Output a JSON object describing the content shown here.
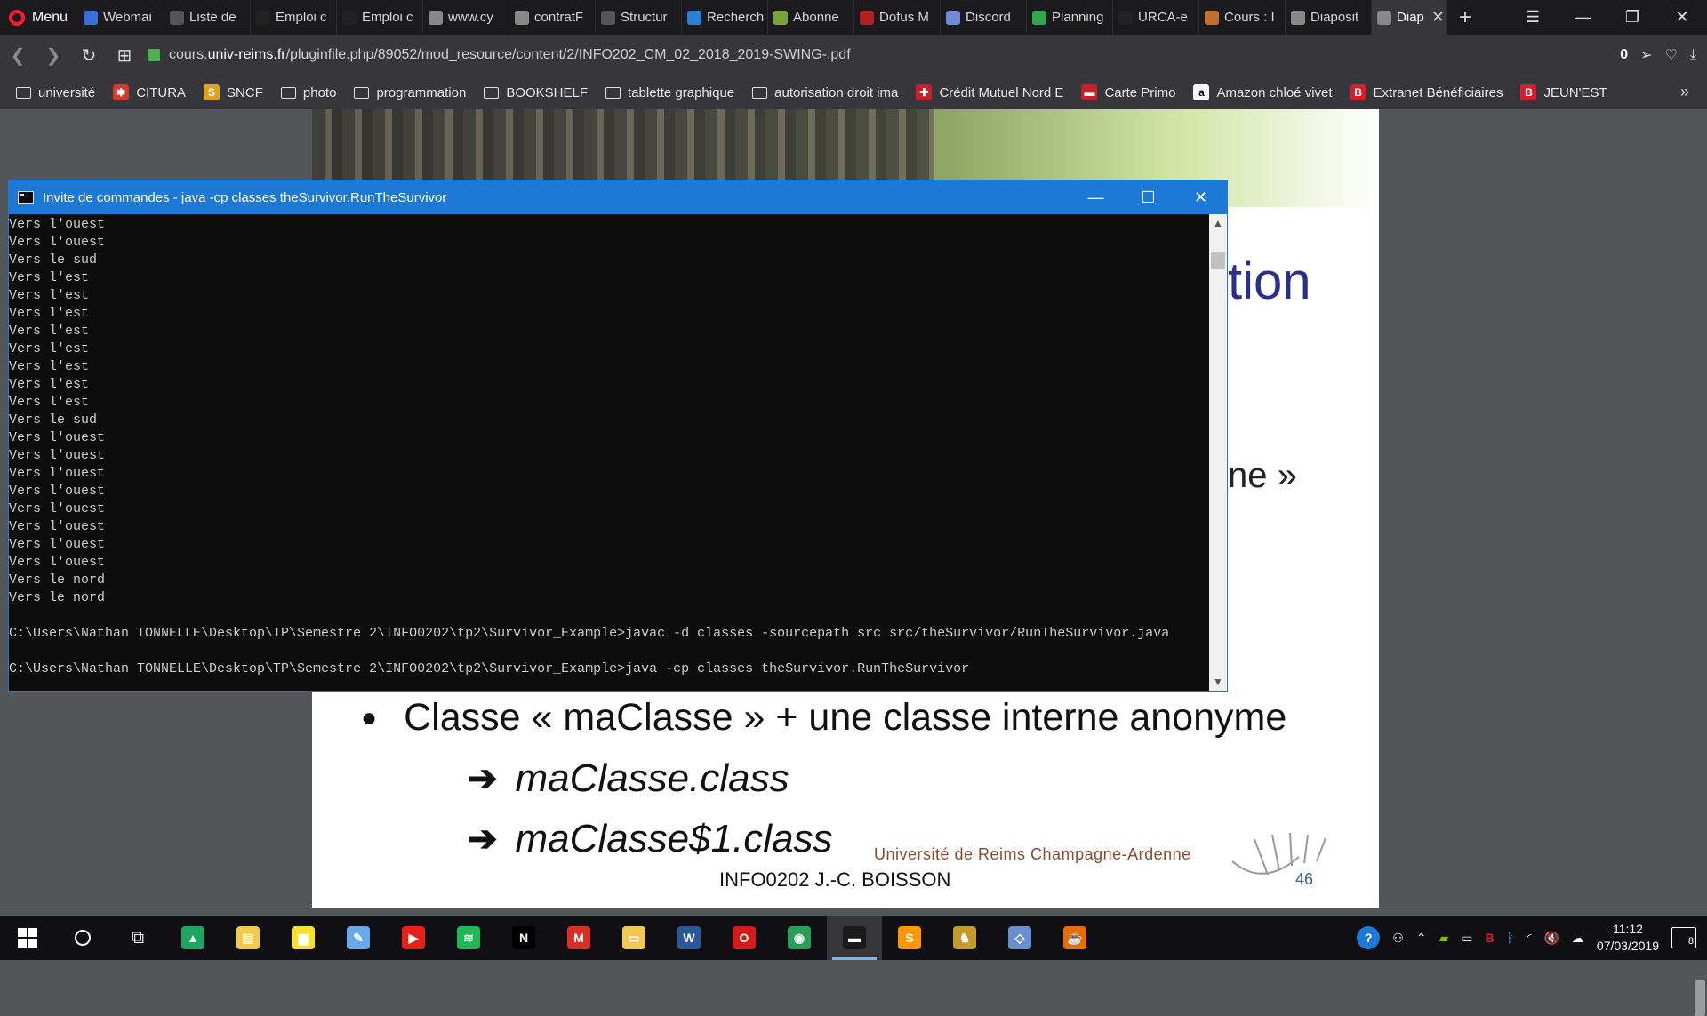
{
  "browser": {
    "menu_label": "Menu",
    "tabs": [
      {
        "label": "Webmai",
        "color": "#3b6fd8"
      },
      {
        "label": "Liste de",
        "color": "#555555"
      },
      {
        "label": "Emploi c",
        "color": "#222222"
      },
      {
        "label": "Emploi c",
        "color": "#222222"
      },
      {
        "label": "www.cy",
        "color": "#888888"
      },
      {
        "label": "contratF",
        "color": "#888888"
      },
      {
        "label": "Structur",
        "color": "#555555"
      },
      {
        "label": "Recherch",
        "color": "#2b7fd6"
      },
      {
        "label": "Abonne",
        "color": "#7aa23b"
      },
      {
        "label": "Dofus M",
        "color": "#b02020"
      },
      {
        "label": "Discord",
        "color": "#7289da"
      },
      {
        "label": "Planning",
        "color": "#2fa84f"
      },
      {
        "label": "URCA-e",
        "color": "#222222"
      },
      {
        "label": "Cours : I",
        "color": "#c0702a"
      },
      {
        "label": "Diaposit",
        "color": "#888888"
      }
    ],
    "active_tab": {
      "label": "Diap",
      "color": "#888888"
    },
    "url_prefix": "cours.",
    "url_domain": "univ-reims.fr",
    "url_path": "/pluginfile.php/89052/mod_resource/content/2/INFO202_CM_02_2018_2019-SWING-.pdf",
    "adblock_count": "0"
  },
  "bookmarks": [
    {
      "label": "université",
      "type": "folder"
    },
    {
      "label": "CITURA",
      "type": "fav",
      "color": "#d43a2a",
      "glyph": "✱"
    },
    {
      "label": "SNCF",
      "type": "fav",
      "color": "#e0a020",
      "glyph": "S"
    },
    {
      "label": "photo",
      "type": "folder"
    },
    {
      "label": "programmation",
      "type": "folder"
    },
    {
      "label": "BOOKSHELF",
      "type": "folder"
    },
    {
      "label": "tablette graphique",
      "type": "folder"
    },
    {
      "label": "autorisation droit ima",
      "type": "folder"
    },
    {
      "label": "Crédit Mutuel Nord E",
      "type": "fav",
      "color": "#c8202a",
      "glyph": "✚"
    },
    {
      "label": "Carte Primo",
      "type": "fav",
      "color": "#c8202a",
      "glyph": "▬"
    },
    {
      "label": "Amazon chloé vivet",
      "type": "fav",
      "color": "#ffffff",
      "glyph": "a"
    },
    {
      "label": "Extranet Bénéficiaires",
      "type": "fav",
      "color": "#d81e2a",
      "glyph": "B"
    },
    {
      "label": "JEUN'EST",
      "type": "fav",
      "color": "#d81e2a",
      "glyph": "B"
    }
  ],
  "slide": {
    "heading_fragment_1": "tion",
    "heading_fragment_2": "ne »",
    "bullet": "Classe « maClasse » + une classe interne anonyme",
    "arrow_1": "maClasse.class",
    "arrow_2": "maClasse$1.class",
    "university": "Université de Reims Champagne-Ardenne",
    "course": "INFO0202  J.-C. BOISSON",
    "page_number": "46"
  },
  "cmd": {
    "title": "Invite de commandes - java  -cp classes theSurvivor.RunTheSurvivor",
    "lines": [
      "Vers l'ouest",
      "Vers l'ouest",
      "Vers le sud",
      "Vers l'est",
      "Vers l'est",
      "Vers l'est",
      "Vers l'est",
      "Vers l'est",
      "Vers l'est",
      "Vers l'est",
      "Vers l'est",
      "Vers le sud",
      "Vers l'ouest",
      "Vers l'ouest",
      "Vers l'ouest",
      "Vers l'ouest",
      "Vers l'ouest",
      "Vers l'ouest",
      "Vers l'ouest",
      "Vers l'ouest",
      "Vers le nord",
      "Vers le nord",
      "",
      "C:\\Users\\Nathan TONNELLE\\Desktop\\TP\\Semestre 2\\INFO0202\\tp2\\Survivor_Example>javac -d classes -sourcepath src src/theSurvivor/RunTheSurvivor.java",
      "",
      "C:\\Users\\Nathan TONNELLE\\Desktop\\TP\\Semestre 2\\INFO0202\\tp2\\Survivor_Example>java -cp classes theSurvivor.RunTheSurvivor"
    ]
  },
  "taskbar": {
    "apps": [
      {
        "name": "google-drive",
        "color": "#1fa463",
        "glyph": "▲"
      },
      {
        "name": "file-explorer-yellow",
        "color": "#f2c94c",
        "glyph": "▤"
      },
      {
        "name": "sticky-notes",
        "color": "#f7e12b",
        "glyph": "▆"
      },
      {
        "name": "paint",
        "color": "#6aa9e9",
        "glyph": "✎"
      },
      {
        "name": "youtube",
        "color": "#e62117",
        "glyph": "▶"
      },
      {
        "name": "spotify",
        "color": "#1db954",
        "glyph": "≋"
      },
      {
        "name": "netflix",
        "color": "#000000",
        "glyph": "N"
      },
      {
        "name": "gmail",
        "color": "#d93025",
        "glyph": "M"
      },
      {
        "name": "file-explorer",
        "color": "#f2c94c",
        "glyph": "▭"
      },
      {
        "name": "word",
        "color": "#2b579a",
        "glyph": "W"
      },
      {
        "name": "opera",
        "color": "#d41a1a",
        "glyph": "O"
      },
      {
        "name": "chrome",
        "color": "#2a9d57",
        "glyph": "◉"
      },
      {
        "name": "command-prompt",
        "color": "#1a1a1a",
        "glyph": "▬"
      },
      {
        "name": "sublime-text",
        "color": "#ff9800",
        "glyph": "S"
      },
      {
        "name": "game-app",
        "color": "#c49a2a",
        "glyph": "♞"
      },
      {
        "name": "virtualbox",
        "color": "#6a8fcf",
        "glyph": "◇"
      },
      {
        "name": "java",
        "color": "#e76f00",
        "glyph": "☕"
      }
    ],
    "active_app_index": 12,
    "time": "11:12",
    "date": "07/03/2019",
    "notification_count": "8"
  }
}
